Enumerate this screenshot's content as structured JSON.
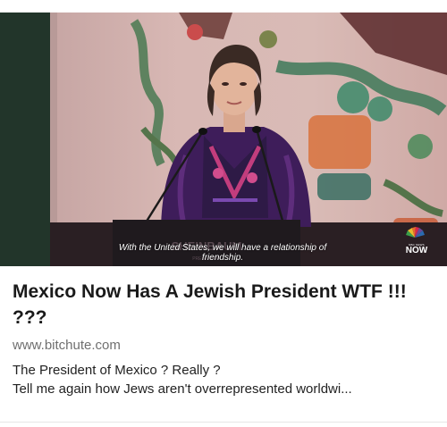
{
  "card": {
    "title": "Mexico Now Has A Jewish President WTF !!! ???",
    "domain": "www.bitchute.com",
    "description_lines": [
      "The President of Mexico ? Really ?",
      "Tell me again how Jews aren't overrepresented worldwi..."
    ]
  },
  "thumbnail": {
    "caption": "With the United States, we will have a relationship of friendship.",
    "broadcaster_logo_small": "NBC NEWS",
    "broadcaster_logo_text": "NOW",
    "podium_text": "SHEINBAUM",
    "podium_subtext": "PRESIDENTA"
  },
  "colors": {
    "title": "#1a1a1a",
    "domain": "#6f6f6f",
    "caption": "#ffffff"
  }
}
